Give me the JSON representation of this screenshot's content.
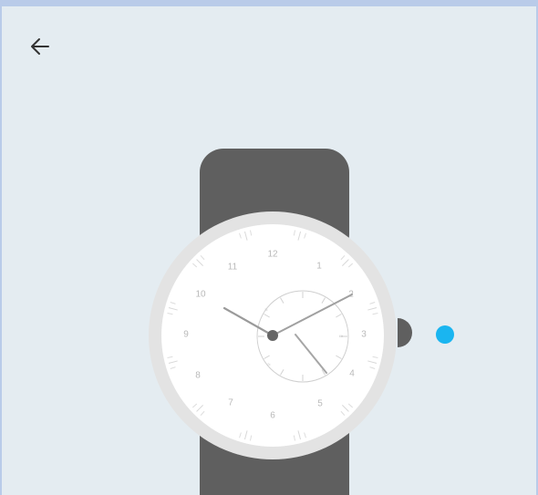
{
  "colors": {
    "frame": "#b9cbe9",
    "background": "#e4ecf1",
    "strap": "#5f5f5f",
    "bezel": "#e3e3e3",
    "face": "#ffffff",
    "hands": "#8a8a8a",
    "indicator": "#1ab5f0"
  },
  "icons": {
    "back": "arrow-left-icon"
  },
  "watch": {
    "dial_numbers": [
      "12",
      "1",
      "2",
      "3",
      "4",
      "5",
      "6",
      "7",
      "8",
      "9",
      "10",
      "11"
    ],
    "subdial_labels": [
      "≈",
      "≈",
      "∞"
    ]
  }
}
